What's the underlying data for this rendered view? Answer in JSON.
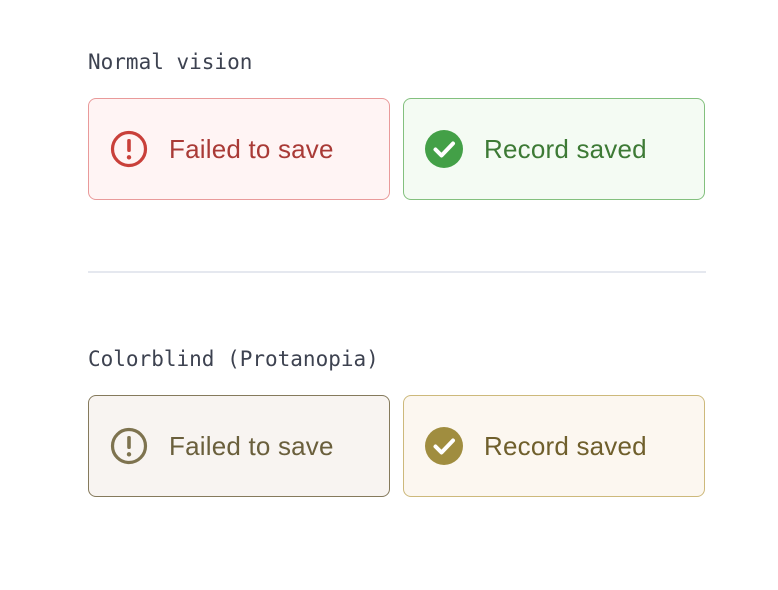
{
  "sections": {
    "normal": {
      "title": "Normal vision",
      "error_toast": {
        "label": "Failed to save",
        "icon": "alert-circle-icon"
      },
      "success_toast": {
        "label": "Record saved",
        "icon": "check-circle-icon"
      }
    },
    "colorblind": {
      "title": "Colorblind (Protanopia)",
      "error_toast": {
        "label": "Failed to save",
        "icon": "alert-circle-icon"
      },
      "success_toast": {
        "label": "Record saved",
        "icon": "check-circle-icon"
      }
    }
  },
  "colors": {
    "normal_error": "#c9403a",
    "normal_success": "#43a047",
    "protanopia_error": "#7e734f",
    "protanopia_success": "#a08d3f"
  }
}
